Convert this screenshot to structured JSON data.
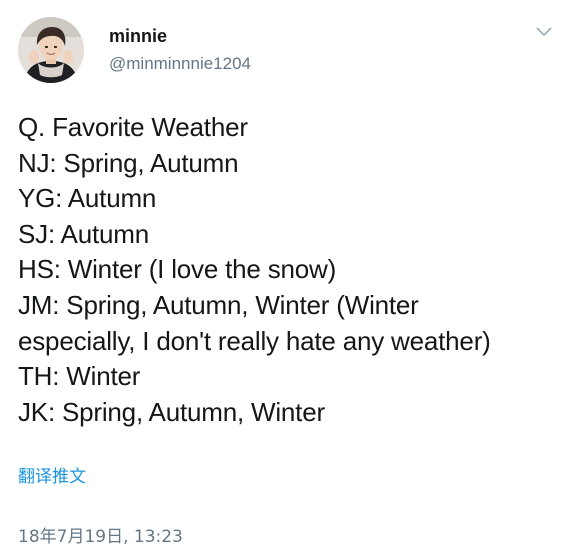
{
  "author": {
    "display_name": "minnie",
    "handle": "@minminnnie1204",
    "avatar_icon": "profile-photo",
    "menu_icon": "chevron-down-icon"
  },
  "tweet": {
    "lines": [
      "Q. Favorite Weather",
      "NJ: Spring, Autumn",
      "YG: Autumn",
      "SJ: Autumn",
      "HS: Winter (I love the snow)",
      "JM: Spring, Autumn, Winter (Winter",
      "especially, I don't really hate any weather)",
      "TH: Winter",
      "JK: Spring, Autumn, Winter"
    ],
    "translate_label": "翻译推文",
    "timestamp": "18年7月19日, 13:23"
  },
  "colors": {
    "text": "#14171a",
    "secondary": "#657786",
    "link": "#1b95e0",
    "background": "#ffffff"
  }
}
